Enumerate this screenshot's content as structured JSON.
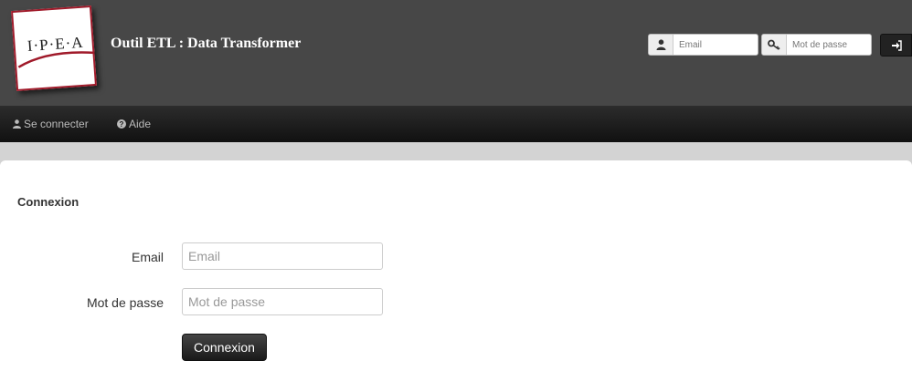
{
  "header": {
    "logo_text": "I·P·E·A",
    "app_title": "Outil ETL : Data Transformer",
    "email_placeholder": "Email",
    "password_placeholder": "Mot de passe",
    "icons": {
      "email": "user-icon",
      "password": "key-icon",
      "login": "sign-in-icon"
    }
  },
  "nav": {
    "items": [
      {
        "label": "Se connecter",
        "icon": "user-icon"
      },
      {
        "label": "Aide",
        "icon": "question-circle-icon"
      }
    ]
  },
  "login_form": {
    "title": "Connexion",
    "email_label": "Email",
    "email_placeholder": "Email",
    "password_label": "Mot de passe",
    "password_placeholder": "Mot de passe",
    "submit_label": "Connexion"
  },
  "colors": {
    "header_bg": "#474747",
    "navbar_bg": "#1a1a1a",
    "logo_accent": "#a01a2a",
    "button_bg": "#222222"
  }
}
